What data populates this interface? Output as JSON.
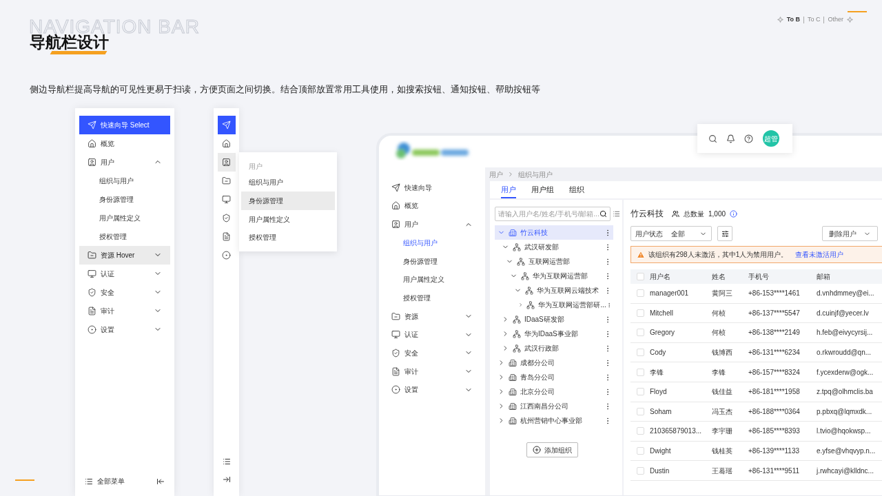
{
  "header": {
    "watermark": "NAVIGATION BAR",
    "title": "导航栏设计",
    "description": "侧边导航栏提高导航的可见性更易于扫读，方便页面之间切换。结合顶部放置常用工具使用，如搜索按钮、通知按钮、帮助按钮等",
    "audience_tabs": [
      {
        "label": "To B",
        "selected": true
      },
      {
        "label": "To C",
        "selected": false
      },
      {
        "label": "Other",
        "selected": false
      }
    ]
  },
  "expanded_sidebar": {
    "items": [
      {
        "kind": "item",
        "label": "快速向导 Select",
        "selected": true,
        "hovered": false
      },
      {
        "kind": "item",
        "label": "概览",
        "selected": false,
        "hovered": false
      },
      {
        "kind": "group",
        "label": "用户",
        "selected": false,
        "hovered": false,
        "expanded": true
      },
      {
        "kind": "sub",
        "label": "组织与用户",
        "selected": false,
        "hovered": false
      },
      {
        "kind": "sub",
        "label": "身份源管理",
        "selected": false,
        "hovered": false
      },
      {
        "kind": "sub",
        "label": "用户属性定义",
        "selected": false,
        "hovered": false
      },
      {
        "kind": "sub",
        "label": "授权管理",
        "selected": false,
        "hovered": false
      },
      {
        "kind": "group",
        "label": "资源 Hover",
        "selected": false,
        "hovered": true,
        "expanded": false
      },
      {
        "kind": "group",
        "label": "认证",
        "selected": false,
        "hovered": false,
        "expanded": false
      },
      {
        "kind": "group",
        "label": "安全",
        "selected": false,
        "hovered": false,
        "expanded": false
      },
      {
        "kind": "group",
        "label": "审计",
        "selected": false,
        "hovered": false,
        "expanded": false
      },
      {
        "kind": "group",
        "label": "设置",
        "selected": false,
        "hovered": false,
        "expanded": false
      }
    ],
    "footer": {
      "label": "全部菜单"
    }
  },
  "collapsed_sidebar": {
    "items": [
      {
        "selected": true,
        "hovered": false
      },
      {
        "selected": false,
        "hovered": false
      },
      {
        "selected": false,
        "hovered": true
      },
      {
        "selected": false,
        "hovered": false
      },
      {
        "selected": false,
        "hovered": false
      },
      {
        "selected": false,
        "hovered": false
      },
      {
        "selected": false,
        "hovered": false
      },
      {
        "selected": false,
        "hovered": false
      }
    ],
    "flyout": {
      "heading": "用户",
      "items": [
        {
          "label": "组织与用户",
          "hovered": false
        },
        {
          "label": "身份源管理",
          "hovered": true
        },
        {
          "label": "用户属性定义",
          "hovered": false
        },
        {
          "label": "授权管理",
          "hovered": false
        }
      ]
    }
  },
  "app": {
    "toolbar": {
      "avatar": "超管"
    },
    "sidebar": {
      "items": [
        {
          "kind": "item",
          "label": "快速向导",
          "selected": false,
          "hovered": false
        },
        {
          "kind": "item",
          "label": "概览",
          "selected": false,
          "hovered": false
        },
        {
          "kind": "group",
          "label": "用户",
          "selected": false,
          "hovered": false,
          "expanded": true
        },
        {
          "kind": "sub",
          "label": "组织与用户",
          "selected": true,
          "hovered": false
        },
        {
          "kind": "sub",
          "label": "身份源管理",
          "selected": false,
          "hovered": false
        },
        {
          "kind": "sub",
          "label": "用户属性定义",
          "selected": false,
          "hovered": false
        },
        {
          "kind": "sub",
          "label": "授权管理",
          "selected": false,
          "hovered": false
        },
        {
          "kind": "group",
          "label": "资源",
          "selected": false,
          "hovered": false,
          "expanded": false
        },
        {
          "kind": "group",
          "label": "认证",
          "selected": false,
          "hovered": false,
          "expanded": false
        },
        {
          "kind": "group",
          "label": "安全",
          "selected": false,
          "hovered": false,
          "expanded": false
        },
        {
          "kind": "group",
          "label": "审计",
          "selected": false,
          "hovered": false,
          "expanded": false
        },
        {
          "kind": "group",
          "label": "设置",
          "selected": false,
          "hovered": false,
          "expanded": false
        }
      ]
    },
    "breadcrumb": [
      "用户",
      "组织与用户"
    ],
    "tabs": [
      {
        "label": "用户",
        "selected": true
      },
      {
        "label": "用户组",
        "selected": false
      },
      {
        "label": "组织",
        "selected": false
      }
    ],
    "tree": {
      "search_placeholder": "请输入用户名/姓名/手机号/邮箱...",
      "nodes": [
        {
          "label": "竹云科技",
          "kind": "company",
          "expanded": true,
          "selected": true,
          "children": [
            {
              "label": "武汉研发部",
              "kind": "department",
              "expanded": true,
              "selected": false,
              "children": [
                {
                  "label": "互联网运营部",
                  "kind": "department",
                  "expanded": true,
                  "selected": false,
                  "children": [
                    {
                      "label": "华为互联网运营部",
                      "kind": "department",
                      "expanded": true,
                      "selected": false,
                      "children": [
                        {
                          "label": "华为互联网云端技术",
                          "kind": "department",
                          "expanded": true,
                          "selected": false,
                          "children": [
                            {
                              "label": "华为互联网运营部研...",
                              "kind": "department",
                              "expanded": false,
                              "selected": false
                            }
                          ]
                        }
                      ]
                    }
                  ]
                }
              ]
            },
            {
              "label": "IDaaS研发部",
              "kind": "department",
              "expanded": false,
              "selected": false
            },
            {
              "label": "华为IDaaS事业部",
              "kind": "department",
              "expanded": false,
              "selected": false
            },
            {
              "label": "武汉行政部",
              "kind": "department",
              "expanded": false,
              "selected": false
            }
          ]
        },
        {
          "label": "成都分公司",
          "kind": "company",
          "expanded": false,
          "selected": false
        },
        {
          "label": "青岛分公司",
          "kind": "company",
          "expanded": false,
          "selected": false
        },
        {
          "label": "北京分公司",
          "kind": "company",
          "expanded": false,
          "selected": false
        },
        {
          "label": "江西南昌分公司",
          "kind": "company",
          "expanded": false,
          "selected": false
        },
        {
          "label": "杭州营销中心事业部",
          "kind": "company",
          "expanded": false,
          "selected": false
        }
      ],
      "add_button": "添加组织"
    },
    "detail": {
      "org": "竹云科技",
      "count_label": "总数量",
      "count": "1,000",
      "filter_label": "用户状态",
      "filter_value": "全部",
      "delete_button": "删除用户",
      "alert": {
        "text": "该组织有298人未激活，其中1人为禁用用户。",
        "link": "查看未激活用户"
      },
      "table": {
        "all_checked": false,
        "columns": [
          "用户名",
          "姓名",
          "手机号",
          "邮箱"
        ],
        "rows": [
          {
            "checked": false,
            "cells": [
              "manager001",
              "黄阿三",
              "+86-153****1461",
              "d.vnhdmmey@ei..."
            ]
          },
          {
            "checked": false,
            "cells": [
              "Mitchell",
              "何桢",
              "+86-137****5547",
              "d.cuinjf@yecer.lv"
            ]
          },
          {
            "checked": false,
            "cells": [
              "Gregory",
              "何桢",
              "+86-138****2149",
              "h.feb@eivycyrsij..."
            ]
          },
          {
            "checked": false,
            "cells": [
              "Cody",
              "钱博西",
              "+86-131****6234",
              "o.rkwroudd@qn..."
            ]
          },
          {
            "checked": false,
            "cells": [
              "李锋",
              "李锋",
              "+86-157****8324",
              "f.ycexderw@ogk..."
            ]
          },
          {
            "checked": false,
            "cells": [
              "Floyd",
              "钱佳益",
              "+86-181****1958",
              "z.tpq@olhmclis.ba"
            ]
          },
          {
            "checked": false,
            "cells": [
              "Soham",
              "冯玉杰",
              "+86-188****0364",
              "p.pbxq@lqmxdk..."
            ]
          },
          {
            "checked": false,
            "cells": [
              "210365879013...",
              "李宇珊",
              "+86-185****8393",
              "l.tvio@hqokwsp..."
            ]
          },
          {
            "checked": false,
            "cells": [
              "Dwight",
              "钱桂英",
              "+86-139****1133",
              "e.yfse@vhqvyp.n..."
            ]
          },
          {
            "checked": false,
            "cells": [
              "Dustin",
              "王蓦瑶",
              "+86-131****9511",
              "j.rwhcayi@klldnc..."
            ]
          }
        ]
      }
    }
  }
}
